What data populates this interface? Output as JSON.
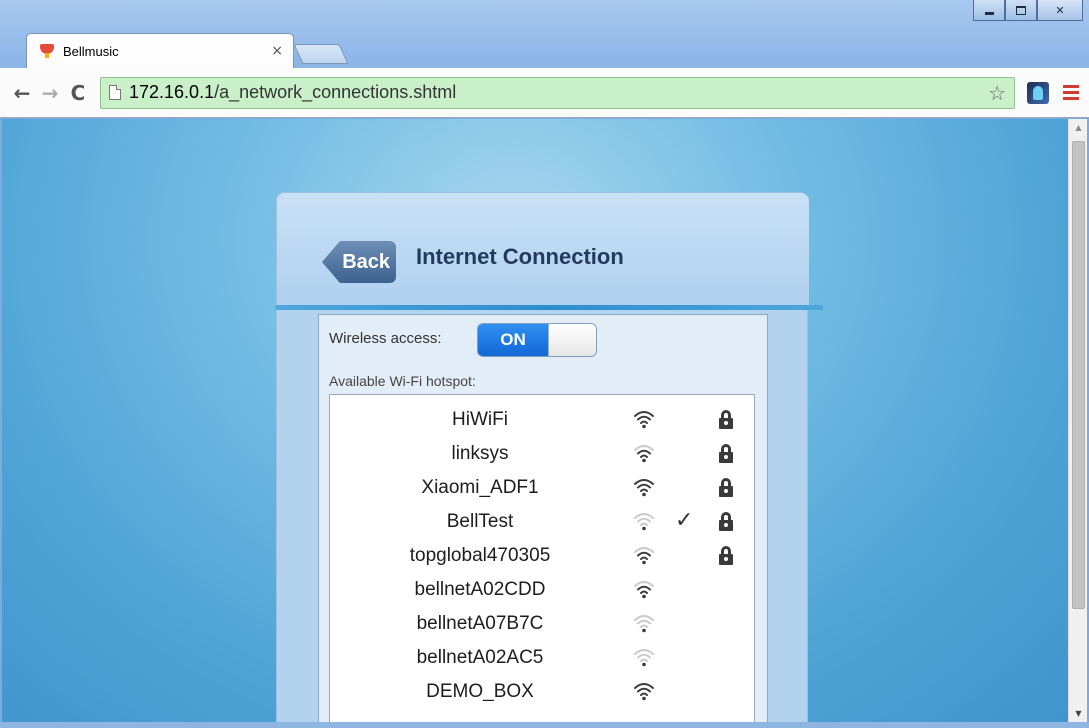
{
  "browser": {
    "tab_title": "Bellmusic",
    "tab_close": "×",
    "url_host": "172.16.0.1",
    "url_path": "/a_network_connections.shtml",
    "star": "☆"
  },
  "page": {
    "back_label": "Back",
    "title": "Internet Connection",
    "wireless_label": "Wireless access:",
    "toggle_label": "ON",
    "toggle_state": true,
    "hotspot_label": "Available Wi-Fi hotspot:"
  },
  "networks": [
    {
      "ssid": "HiWiFi",
      "signal": 4,
      "connected": false,
      "locked": true
    },
    {
      "ssid": "linksys",
      "signal": 3,
      "connected": false,
      "locked": true
    },
    {
      "ssid": "Xiaomi_ADF1",
      "signal": 4,
      "connected": false,
      "locked": true
    },
    {
      "ssid": "BellTest",
      "signal": 1,
      "connected": true,
      "locked": true
    },
    {
      "ssid": "topglobal470305",
      "signal": 3,
      "connected": false,
      "locked": true
    },
    {
      "ssid": "bellnetA02CDD",
      "signal": 3,
      "connected": false,
      "locked": false
    },
    {
      "ssid": "bellnetA07B7C",
      "signal": 1,
      "connected": false,
      "locked": false
    },
    {
      "ssid": "bellnetA02AC5",
      "signal": 1,
      "connected": false,
      "locked": false
    },
    {
      "ssid": "DEMO_BOX",
      "signal": 4,
      "connected": false,
      "locked": false
    }
  ],
  "check_glyph": "✓",
  "colors": {
    "signal_dark": "#3b3b3b",
    "signal_light": "#c9c9c9",
    "toggle_on": "#1a78e2",
    "omnibox": "#c9f0c9"
  }
}
